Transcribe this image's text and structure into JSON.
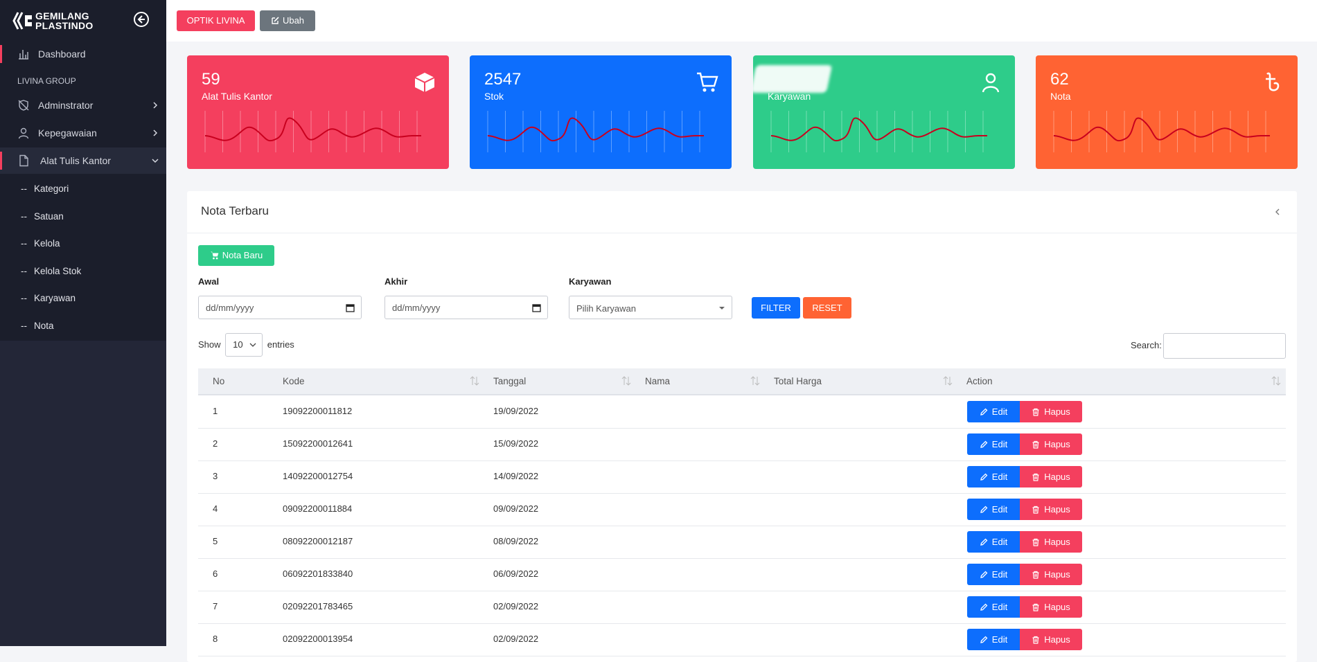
{
  "brand": {
    "line1": "GEMILANG",
    "line2": "PLASTINDO"
  },
  "sidebar": {
    "dashboard": "Dashboard",
    "section": "LIVINA GROUP",
    "items": [
      {
        "label": "Adminstrator",
        "icon": "shield-off-icon"
      },
      {
        "label": "Kepegawaian",
        "icon": "user-icon"
      },
      {
        "label": "Alat Tulis Kantor",
        "icon": "file-icon"
      }
    ],
    "subitems": [
      "Kategori",
      "Satuan",
      "Kelola",
      "Kelola Stok",
      "Karyawan",
      "Nota"
    ],
    "dash": "--"
  },
  "topbar": {
    "store_label": "OPTIK LIVINA",
    "edit_label": "Ubah"
  },
  "cards": [
    {
      "value": "59",
      "title": "Alat Tulis Kantor",
      "color": "#f43f5e",
      "icon": "box-icon"
    },
    {
      "value": "2547",
      "title": "Stok",
      "color": "#0d6efd",
      "icon": "cart-icon"
    },
    {
      "value": "",
      "title": "Karyawan",
      "color": "#2ecc8a",
      "icon": "user-icon"
    },
    {
      "value": "62",
      "title": "Nota",
      "color": "#ff6333",
      "icon": "taka-icon"
    }
  ],
  "panel": {
    "title": "Nota Terbaru",
    "new_button": "Nota Baru",
    "filters": {
      "start_label": "Awal",
      "start_placeholder": "dd/mm/yyyy",
      "end_label": "Akhir",
      "end_placeholder": "dd/mm/yyyy",
      "employee_label": "Karyawan",
      "employee_selected": "Pilih Karyawan",
      "filter_button": "FILTER",
      "reset_button": "RESET"
    },
    "show": {
      "prefix": "Show",
      "value": "10",
      "suffix": "entries"
    },
    "search_label": "Search:"
  },
  "table": {
    "columns": [
      "No",
      "Kode",
      "Tanggal",
      "Nama",
      "Total Harga",
      "Action"
    ],
    "edit_label": "Edit",
    "delete_label": "Hapus",
    "rows": [
      {
        "no": "1",
        "kode": "19092200011812",
        "tanggal": "19/09/2022"
      },
      {
        "no": "2",
        "kode": "15092200012641",
        "tanggal": "15/09/2022"
      },
      {
        "no": "3",
        "kode": "14092200012754",
        "tanggal": "14/09/2022"
      },
      {
        "no": "4",
        "kode": "09092200011884",
        "tanggal": "09/09/2022"
      },
      {
        "no": "5",
        "kode": "08092200012187",
        "tanggal": "08/09/2022"
      },
      {
        "no": "6",
        "kode": "06092201833840",
        "tanggal": "06/09/2022"
      },
      {
        "no": "7",
        "kode": "02092201783465",
        "tanggal": "02/09/2022"
      },
      {
        "no": "8",
        "kode": "02092200013954",
        "tanggal": "02/09/2022"
      }
    ]
  },
  "colors": {
    "red": "#f43f5e",
    "blue": "#0d6efd",
    "green": "#2ecc8a",
    "orange": "#ff6333",
    "sidebar": "#1b1e2b"
  }
}
